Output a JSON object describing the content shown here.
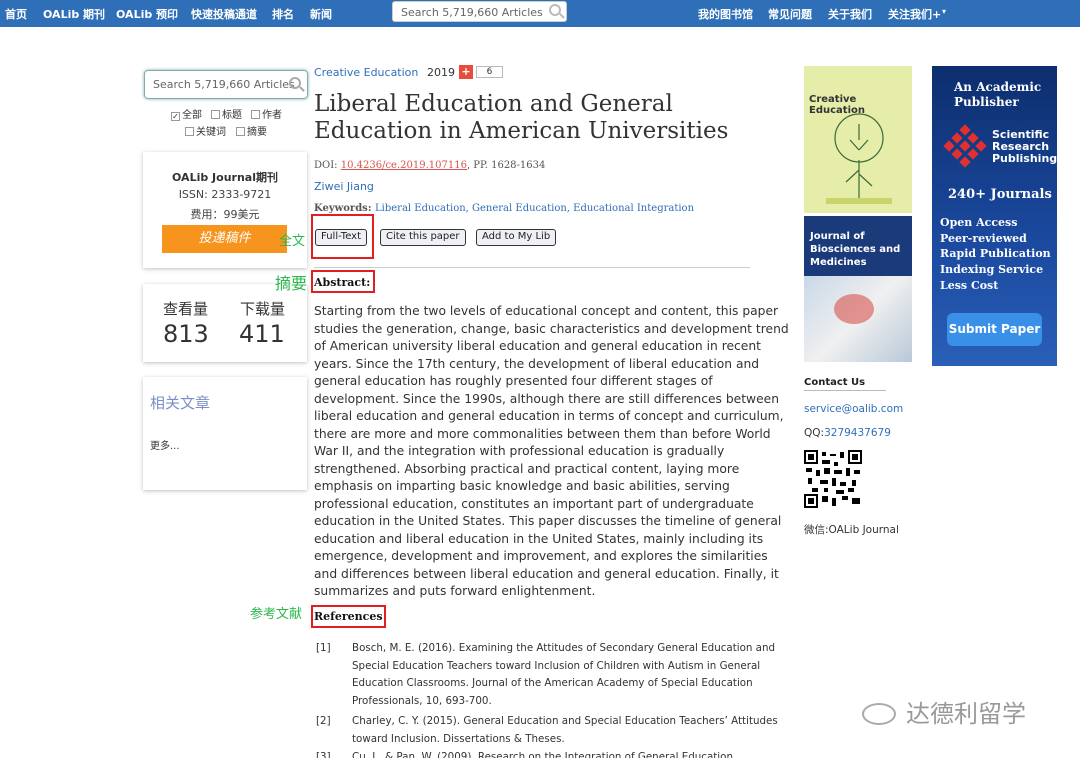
{
  "topnav": {
    "items": [
      "首页",
      "OALib 期刊",
      "OALib 预印",
      "快速投稿通道",
      "排名",
      "新闻"
    ],
    "search_placeholder": "Search 5,719,660 Articles",
    "right_items": [
      "我的图书馆",
      "常见问题",
      "关于我们",
      "关注我们+"
    ]
  },
  "sidebar": {
    "search_placeholder": "Search 5,719,660 Articles",
    "filters": [
      {
        "label": "全部",
        "checked": true
      },
      {
        "label": "标题",
        "checked": false
      },
      {
        "label": "作者",
        "checked": false
      },
      {
        "label": "关键词",
        "checked": false
      },
      {
        "label": "摘要",
        "checked": false
      }
    ],
    "journal": {
      "title": "OALib Journal期刊",
      "issn": "ISSN: 2333-9721",
      "fee": "费用：99美元",
      "submit": "投递稿件"
    },
    "stats": {
      "views_label": "查看量",
      "views": "813",
      "downloads_label": "下载量",
      "downloads": "411"
    },
    "related": {
      "title": "相关文章",
      "more": "更多..."
    }
  },
  "article": {
    "journal": "Creative Education",
    "year": "2019",
    "plus": "+",
    "count": "6",
    "title": "Liberal Education and General Education in American Universities",
    "doi_label": "DOI: ",
    "doi": "10.4236/ce.2019.107116",
    "pages": ", PP. 1628-1634",
    "author": "Ziwei Jiang",
    "keywords_label": "Keywords: ",
    "keywords": "Liberal Education, General Education, Educational Integration",
    "buttons": {
      "fulltext": "Full-Text",
      "cite": "Cite this paper",
      "add": "Add to My Lib"
    },
    "abstract_heading": "Abstract:",
    "abstract": "Starting from the two levels of educational concept and content, this paper studies the generation, change, basic characteristics and development trend of American university liberal education and general education in recent years. Since the 17th century, the development of liberal education and general education has roughly presented four different stages of development. Since the 1990s, although there are still differences between liberal education and general education in terms of concept and curriculum, there are more and more commonalities between them than before World War II, and the integration with professional education is gradually strengthened. Absorbing practical and practical content, laying more emphasis on imparting basic knowledge and basic abilities, serving professional education, constitutes an important part of undergraduate education in the United States. This paper discusses the timeline of general education and liberal education in the United States, mainly including its emergence, development and improvement, and explores the similarities and differences between liberal education and general education. Finally, it summarizes and puts forward enlightenment.",
    "references_heading": "References",
    "references": [
      {
        "n": "[1]",
        "text": "Bosch, M. E. (2016). Examining the Attitudes of Secondary General Education and Special Education Teachers toward Inclusion of Children with Autism in General Education Classrooms. Journal of the American Academy of Special Education Professionals, 10, 693-700."
      },
      {
        "n": "[2]",
        "text": "Charley, C. Y. (2015). General Education and Special Education Teachers’ Attitudes toward Inclusion. Dissertations & Theses."
      },
      {
        "n": "[3]",
        "text": "Cu, J., & Pan, W. (2009). Research on the Integration of General Education"
      }
    ]
  },
  "annotations": {
    "fulltext": "全文",
    "abstract": "摘要",
    "references": "参考文献"
  },
  "right": {
    "cover1_title": "Creative Education",
    "cover2_title": "Journal of Biosciences and Medicines",
    "contact_heading": "Contact Us",
    "email": "service@oalib.com",
    "qq_label": "QQ:",
    "qq": "3279437679",
    "wechat": "微信:OALib Journal"
  },
  "ad": {
    "headline1": "An Academic",
    "headline2": "Publisher",
    "logo_text1": "Scientific",
    "logo_text2": "Research",
    "logo_text3": "Publishing",
    "journals": "240+ Journals",
    "features": [
      "Open Access",
      "Peer-reviewed",
      "Rapid Publication",
      "Indexing Service",
      "Less Cost"
    ],
    "submit": "Submit Paper"
  },
  "watermark": "达德利留学",
  "colors": {
    "nav": "#2f6fb8",
    "accent_orange": "#f7941d",
    "annot_red": "#e02020",
    "annot_green": "#2db84d"
  }
}
